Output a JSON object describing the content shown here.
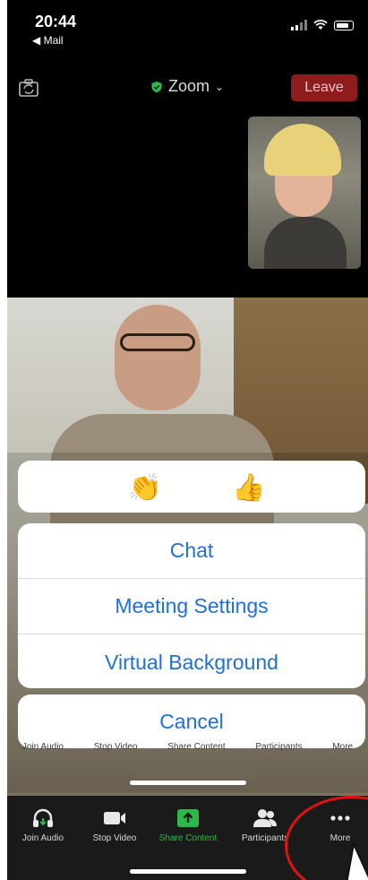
{
  "status_bar": {
    "time": "20:44",
    "back_app": "Mail",
    "back_arrow_icon": "back-triangle-icon",
    "signal_icon": "cellular-signal-icon",
    "wifi_icon": "wifi-icon",
    "battery_icon": "battery-icon"
  },
  "meeting_bar": {
    "flip_camera_icon": "flip-camera-icon",
    "title": "Zoom",
    "shield_icon": "shield-check-icon",
    "dropdown_icon": "chevron-down-icon",
    "leave_label": "Leave",
    "leave_color": "#8f1c1c",
    "title_accent": "#2db84b"
  },
  "reactions": {
    "clap": "👏",
    "thumbs_up": "👍"
  },
  "menu": {
    "items": [
      {
        "label": "Chat"
      },
      {
        "label": "Meeting Settings"
      },
      {
        "label": "Virtual Background"
      }
    ],
    "cancel_label": "Cancel",
    "accent_color": "#1f6fd6"
  },
  "toolbar": {
    "items": [
      {
        "label": "Join Audio",
        "icon": "headphones-icon"
      },
      {
        "label": "Stop Video",
        "icon": "video-camera-icon"
      },
      {
        "label": "Share Content",
        "icon": "share-screen-icon",
        "color": "#2db84b"
      },
      {
        "label": "Participants",
        "icon": "participants-icon"
      },
      {
        "label": "More",
        "icon": "more-dots-icon"
      }
    ]
  },
  "behind_sheet_labels": [
    "Join Audio",
    "Stop Video",
    "Share Content",
    "Participants",
    "More"
  ]
}
